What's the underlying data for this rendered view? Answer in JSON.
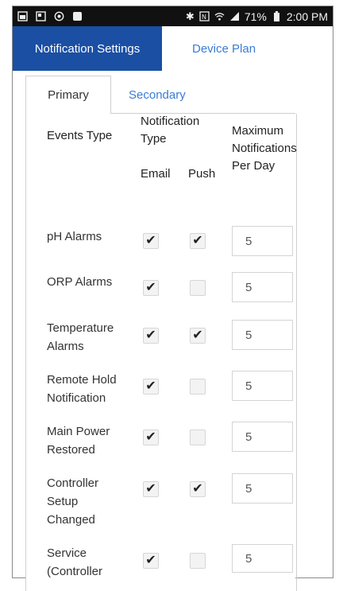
{
  "status_bar": {
    "battery_percent": "71%",
    "time": "2:00 PM",
    "left_icons": [
      "gallery-icon",
      "screenshot-icon",
      "target-icon",
      "app-icon"
    ],
    "right_icons": [
      "bluetooth-icon",
      "nfc-icon",
      "wifi-icon",
      "signal-icon",
      "battery-icon"
    ]
  },
  "tabs": {
    "active": "Notification Settings",
    "inactive": "Device Plan"
  },
  "subtabs": {
    "active": "Primary",
    "inactive": "Secondary"
  },
  "table": {
    "header_events": "Events Type",
    "header_notification": "Notification Type",
    "header_email": "Email",
    "header_push": "Push",
    "header_max": "Maximum Notifications Per Day",
    "rows": [
      {
        "label": "pH Alarms",
        "email": true,
        "push": true,
        "max": "5"
      },
      {
        "label": "ORP Alarms",
        "email": true,
        "push": false,
        "max": "5"
      },
      {
        "label": "Temperature Alarms",
        "email": true,
        "push": true,
        "max": "5"
      },
      {
        "label": "Remote Hold Notification",
        "email": true,
        "push": false,
        "max": "5"
      },
      {
        "label": "Main Power Restored",
        "email": true,
        "push": false,
        "max": "5"
      },
      {
        "label": "Controller Setup Changed",
        "email": true,
        "push": true,
        "max": "5"
      },
      {
        "label": "Service (Controller",
        "email": true,
        "push": false,
        "max": "5"
      }
    ]
  },
  "colors": {
    "tab_active_bg": "#1a4fa3",
    "link": "#3a7bd5",
    "status_bar_bg": "#111111"
  }
}
